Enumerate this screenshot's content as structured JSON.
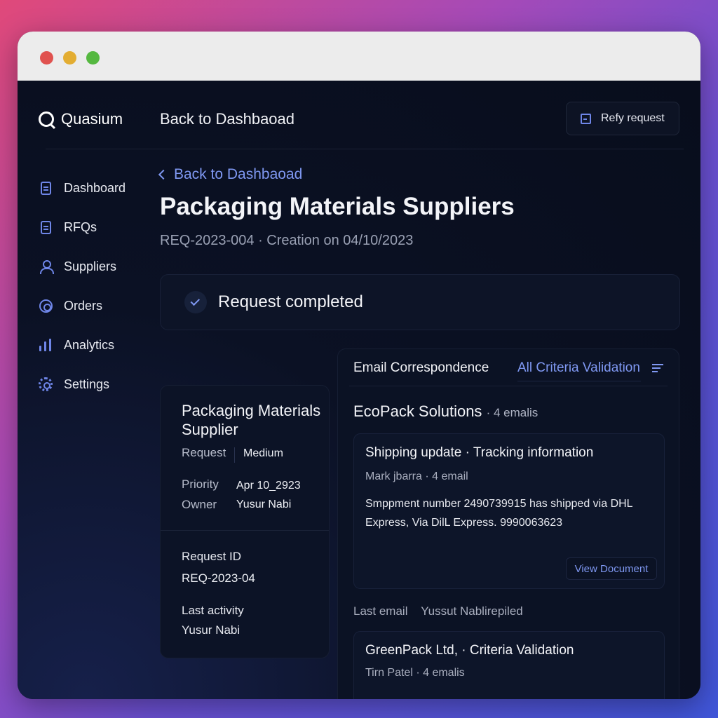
{
  "app": {
    "name": "Quasium"
  },
  "header": {
    "title": "Back to Dashbaoad",
    "action_label": "Refy request"
  },
  "sidebar": {
    "items": [
      {
        "label": "Dashboard",
        "icon": "dashboard-icon"
      },
      {
        "label": "RFQs",
        "icon": "document-icon"
      },
      {
        "label": "Suppliers",
        "icon": "user-icon"
      },
      {
        "label": "Orders",
        "icon": "orders-icon"
      },
      {
        "label": "Analytics",
        "icon": "bar-chart-icon"
      },
      {
        "label": "Settings",
        "icon": "gear-icon"
      }
    ]
  },
  "page": {
    "back_link": "Back to Dashbaoad",
    "title": "Packaging Materials Suppliers",
    "meta": "REQ-2023-004 · Creation on 04/10/2023",
    "status": "Request completed"
  },
  "info": {
    "title": "Packaging Materials Supplier",
    "rows": [
      {
        "label": "Request",
        "value": "Medium"
      },
      {
        "label": "Priority",
        "value": "Apr 10_2923"
      },
      {
        "label": "Owner",
        "value": "Yusur Nabi"
      }
    ],
    "request_id_label": "Request ID",
    "request_id": "REQ-2023-04",
    "last_activity_label": "Last activity",
    "last_activity": "Yusur Nabi"
  },
  "emails": {
    "heading": "Email Correspondence",
    "tab": "All Criteria Validation",
    "company": "EcoPack Solutions",
    "company_count": "· 4 emalis",
    "messages": [
      {
        "subject": "Shipping update · Tracking information",
        "from": "Mark jbarra · 4 email",
        "body": "Smppment number 2490739915 has shipped via DHL Express, Via DilL Express. 9990063623",
        "action": "View Document"
      },
      {
        "subject": "GreenPack Ltd, · Criteria Validation",
        "from": "Tirn Patel · 4 emalis"
      }
    ],
    "last_email_label": "Last email",
    "last_email_value": "Yussut Nablirepiled"
  },
  "colors": {
    "accent": "#7f98f2",
    "background": "#0a1020"
  }
}
